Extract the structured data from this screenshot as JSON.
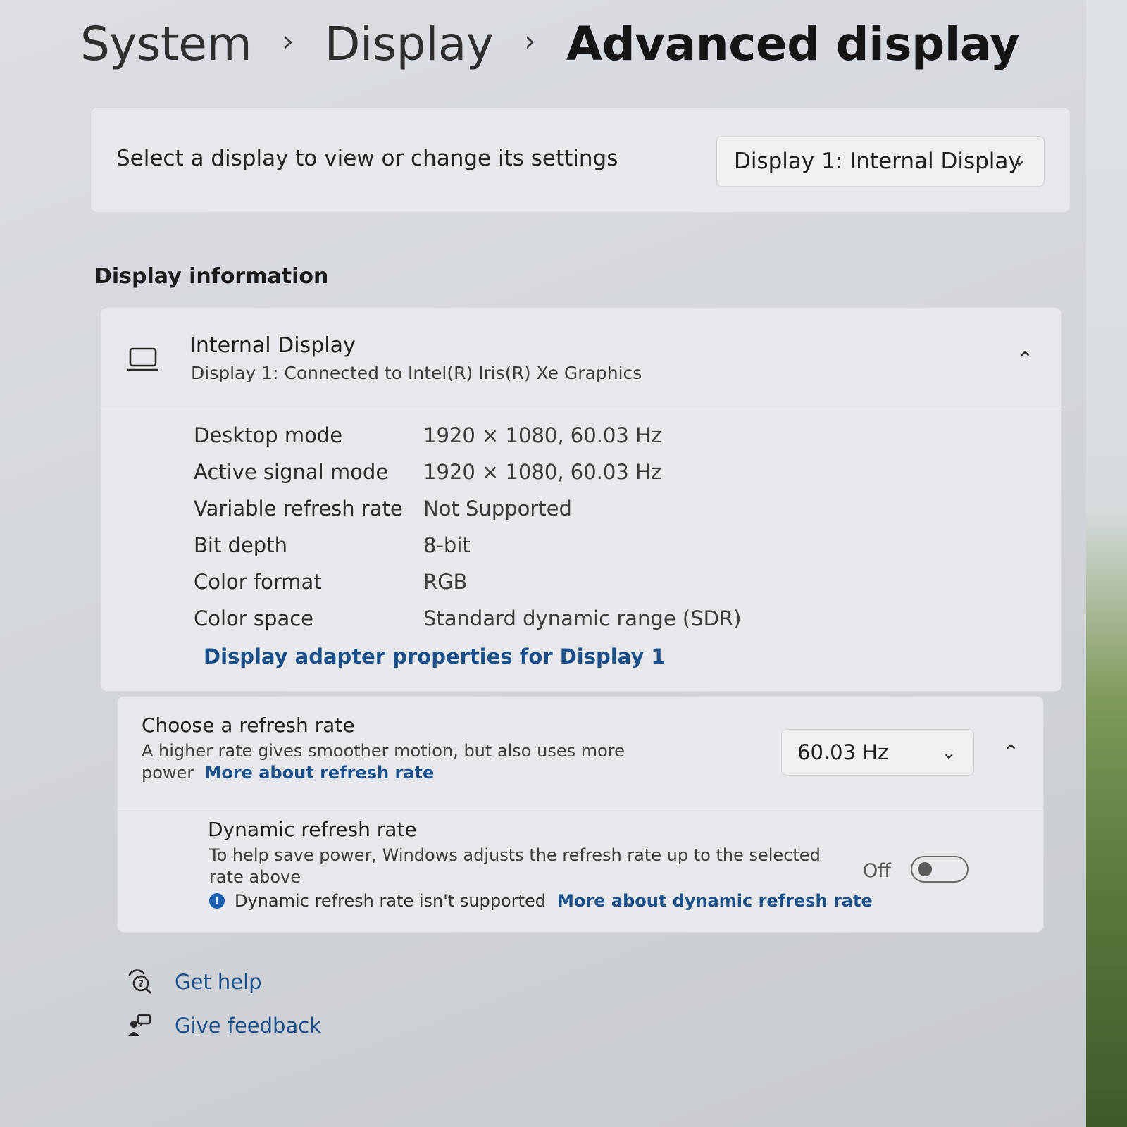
{
  "breadcrumb": {
    "items": [
      "System",
      "Display"
    ],
    "current": "Advanced display",
    "separator": "›"
  },
  "display_select": {
    "label": "Select a display to view or change its settings",
    "selected": "Display 1: Internal Display"
  },
  "display_info": {
    "heading": "Display information",
    "title": "Internal Display",
    "subtitle": "Display 1: Connected to Intel(R) Iris(R) Xe Graphics",
    "properties": [
      {
        "name": "Desktop mode",
        "value": "1920 × 1080, 60.03 Hz"
      },
      {
        "name": "Active signal mode",
        "value": "1920 × 1080, 60.03 Hz"
      },
      {
        "name": "Variable refresh rate",
        "value": "Not Supported"
      },
      {
        "name": "Bit depth",
        "value": "8-bit"
      },
      {
        "name": "Color format",
        "value": "RGB"
      },
      {
        "name": "Color space",
        "value": "Standard dynamic range (SDR)"
      }
    ],
    "adapter_link": "Display adapter properties for Display 1"
  },
  "refresh_rate": {
    "title": "Choose a refresh rate",
    "description": "A higher rate gives smoother motion, but also uses more power",
    "link": "More about refresh rate",
    "selected": "60.03 Hz"
  },
  "dynamic_refresh": {
    "title": "Dynamic refresh rate",
    "description": "To help save power, Windows adjusts the refresh rate up to the selected rate above",
    "note": "Dynamic refresh rate isn't supported",
    "link": "More about dynamic refresh rate",
    "toggle_state": "Off"
  },
  "footer": {
    "help": "Get help",
    "feedback": "Give feedback"
  },
  "icons": {
    "breadcrumb_separator": "chevron-right-icon",
    "dropdown": "chevron-down-icon",
    "collapse": "chevron-up-icon",
    "display": "laptop-icon",
    "info": "info-icon",
    "help": "help-icon",
    "feedback": "feedback-icon"
  },
  "colors": {
    "link": "#1a4f8a",
    "info_dot": "#1d5fb0"
  }
}
